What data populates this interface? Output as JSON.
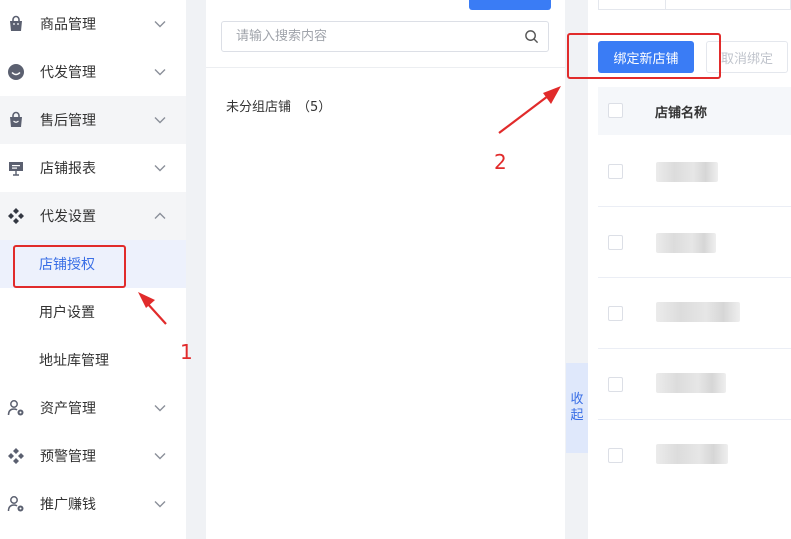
{
  "sidebar": {
    "items": [
      {
        "label": "商品管理",
        "icon": "bag-icon"
      },
      {
        "label": "代发管理",
        "icon": "smile-face-icon"
      },
      {
        "label": "售后管理",
        "icon": "bag-icon"
      },
      {
        "label": "店铺报表",
        "icon": "presentation-board-icon"
      },
      {
        "label": "代发设置",
        "icon": "diamond-grid-icon"
      },
      {
        "label": "资产管理",
        "icon": "user-gear-icon"
      },
      {
        "label": "预警管理",
        "icon": "diamond-grid-icon"
      },
      {
        "label": "推广赚钱",
        "icon": "user-gear-icon"
      }
    ],
    "submenu": [
      {
        "label": "店铺授权"
      },
      {
        "label": "用户设置"
      },
      {
        "label": "地址库管理"
      }
    ]
  },
  "middle": {
    "search_placeholder": "请输入搜索内容",
    "group_name": "未分组店铺",
    "group_count": "（5）"
  },
  "collapse": {
    "char1": "收",
    "char2": "起"
  },
  "right": {
    "bind_label": "绑定新店铺",
    "unbind_label": "取消绑定",
    "column_store_name": "店铺名称"
  },
  "annotations": {
    "step1": "1",
    "step2": "2"
  },
  "colors": {
    "accent": "#3a7cf5",
    "annotation": "#e12b2b",
    "active_bg": "#edf1fc"
  }
}
